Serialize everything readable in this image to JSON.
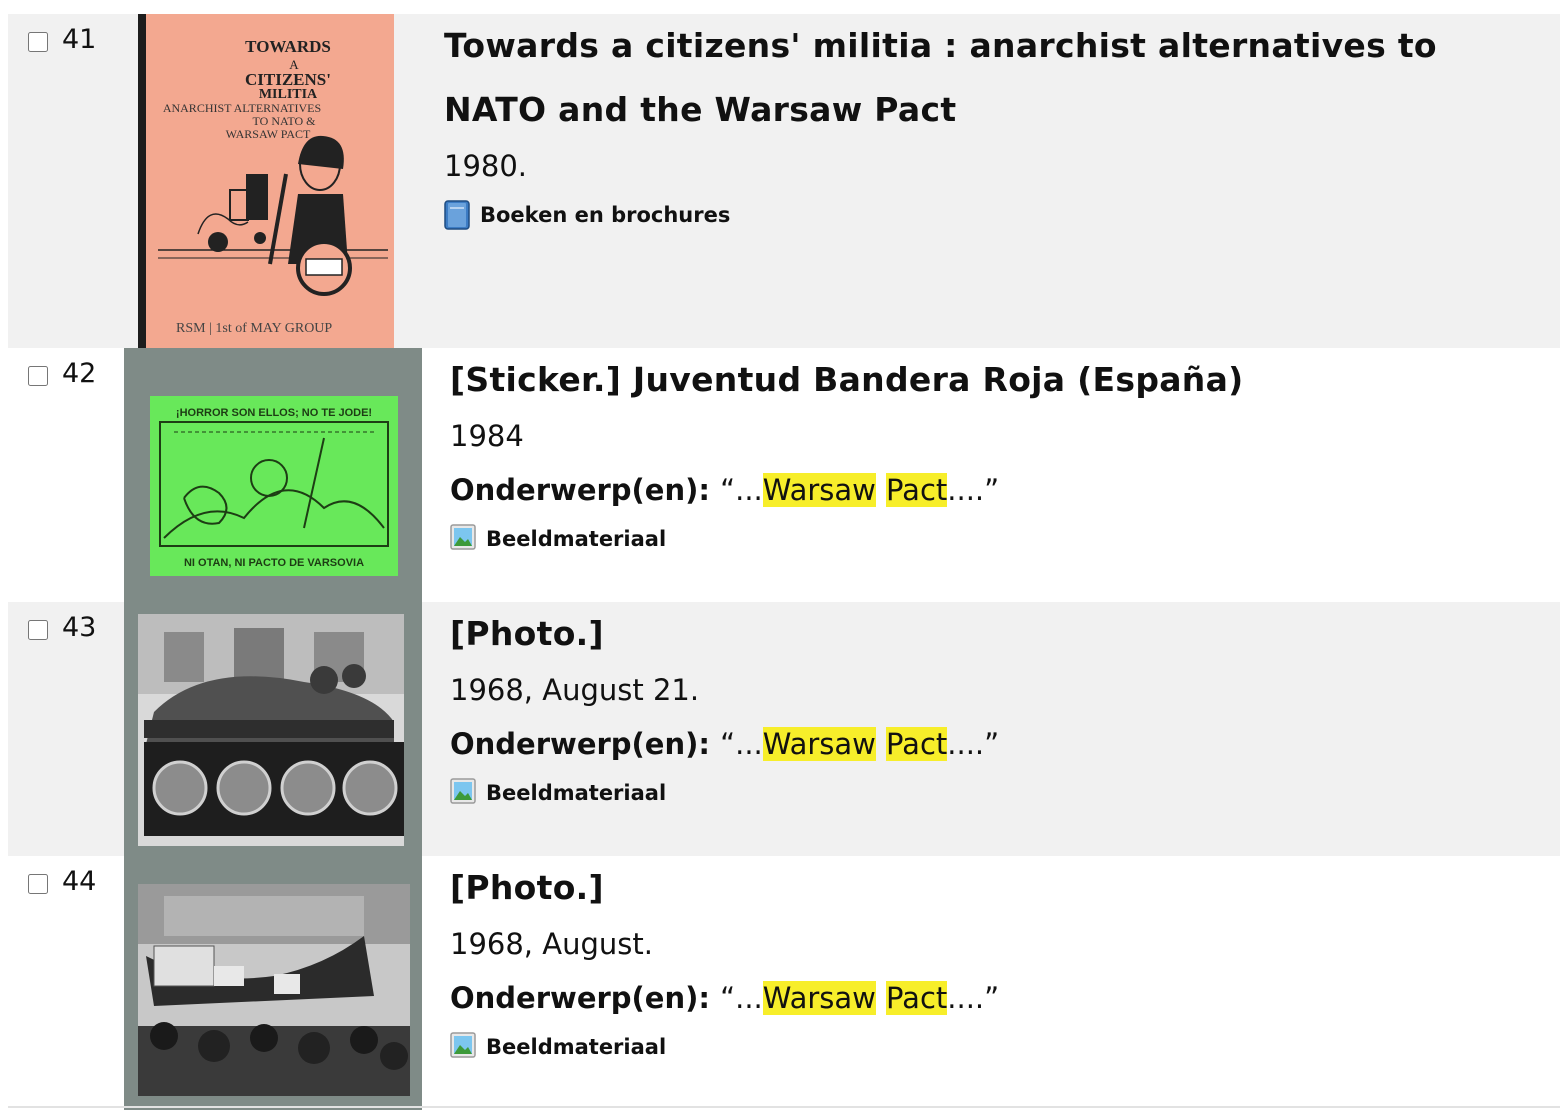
{
  "results": [
    {
      "number": "41",
      "title": "Towards a citizens' militia : anarchist alternatives to NATO and the Warsaw Pact",
      "date": "1980.",
      "type": "Boeken en brochures",
      "type_icon": "book-icon",
      "thumbnail": {
        "kind": "book-cover",
        "lines": [
          "TOWARDS",
          "A",
          "CITIZENS'",
          "MILITIA",
          "ANARCHIST ALTERNATIVES",
          "TO NATO &",
          "WARSAW PACT",
          "RSM | 1st of MAY GROUP"
        ],
        "bg": "#f3a890"
      }
    },
    {
      "number": "42",
      "title": "[Sticker.] Juventud Bandera Roja (España)",
      "date": "1984",
      "subject_label": "Onderwerp(en):",
      "subject_prefix": "“...",
      "subject_hl1": "Warsaw",
      "subject_hl2": "Pact",
      "subject_suffix": "....”",
      "type": "Beeldmateriaal",
      "type_icon": "image-icon",
      "thumbnail": {
        "kind": "sticker",
        "top_text": "¡HORROR SON ELLOS; NO TE JODE!",
        "bottom_text": "NI OTAN, NI PACTO DE VARSOVIA",
        "bg": "#68e85a"
      }
    },
    {
      "number": "43",
      "title": "[Photo.]",
      "date": "1968, August 21.",
      "subject_label": "Onderwerp(en):",
      "subject_prefix": "“...",
      "subject_hl1": "Warsaw",
      "subject_hl2": "Pact",
      "subject_suffix": "....”",
      "type": "Beeldmateriaal",
      "type_icon": "image-icon",
      "thumbnail": {
        "kind": "photo-tank"
      }
    },
    {
      "number": "44",
      "title": "[Photo.]",
      "date": "1968, August.",
      "subject_label": "Onderwerp(en):",
      "subject_prefix": "“...",
      "subject_hl1": "Warsaw",
      "subject_hl2": "Pact",
      "subject_suffix": "....”",
      "type": "Beeldmateriaal",
      "type_icon": "image-icon",
      "thumbnail": {
        "kind": "photo-crowd"
      }
    }
  ],
  "colors": {
    "row_shade": "#f1f1f1",
    "highlight": "#f7ee2a",
    "thumb_frame": "#7f8b87"
  }
}
